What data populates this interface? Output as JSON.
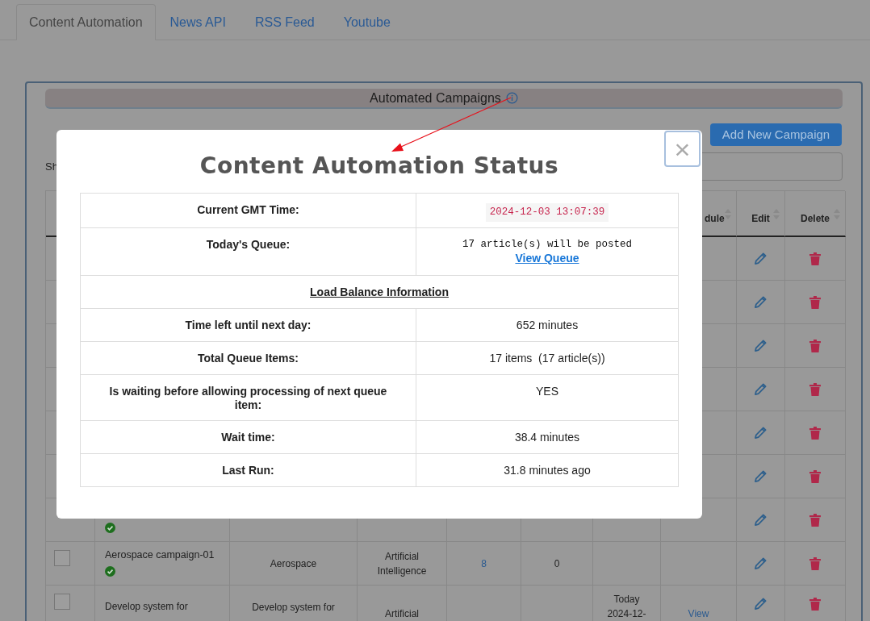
{
  "tabs": [
    {
      "label": "Content Automation",
      "selected": true
    },
    {
      "label": "News API",
      "selected": false
    },
    {
      "label": "RSS Feed",
      "selected": false
    },
    {
      "label": "Youtube",
      "selected": false
    }
  ],
  "panel": {
    "title": "Automated Campaigns",
    "add_button": "Add New Campaign",
    "show_entries": "Sh",
    "table": {
      "columns": [
        {
          "label": "dule",
          "sortable": true
        },
        {
          "label": "Edit",
          "sortable": true
        },
        {
          "label": "Delete",
          "sortable": true
        }
      ],
      "rows": [
        {},
        {},
        {},
        {},
        {},
        {},
        {
          "verified": true
        },
        {
          "checked": false,
          "name": "Aerospace campaign-01",
          "verified": true,
          "category": "Aerospace",
          "topic": "Artificial Intelligence",
          "articles": "8",
          "posted": "0"
        },
        {
          "checked": false,
          "name": "Develop system for",
          "category": "Develop system for",
          "topic": "Artificial",
          "schedule": "Today 2024-12-",
          "schedule_link": "View"
        }
      ]
    }
  },
  "modal": {
    "title": "Content Automation Status",
    "close": "×",
    "rows": [
      {
        "kind": "time",
        "label": "Current GMT Time:",
        "value": "2024-12-03 13:07:39"
      },
      {
        "kind": "queue",
        "label": "Today's Queue:",
        "value": "17 article(s) will be posted",
        "link": "View Queue"
      },
      {
        "kind": "section",
        "label": "Load Balance Information"
      },
      {
        "kind": "pair",
        "label": "Time left until next day:",
        "value": "652 minutes"
      },
      {
        "kind": "pair",
        "label": "Total Queue Items:",
        "value": "17 items  (17 article(s))"
      },
      {
        "kind": "pair",
        "label": "Is waiting before allowing processing of next queue item:",
        "value": "YES"
      },
      {
        "kind": "pair",
        "label": "Wait time:",
        "value": "38.4 minutes"
      },
      {
        "kind": "pair",
        "label": "Last Run:",
        "value": "31.8 minutes ago"
      }
    ]
  }
}
